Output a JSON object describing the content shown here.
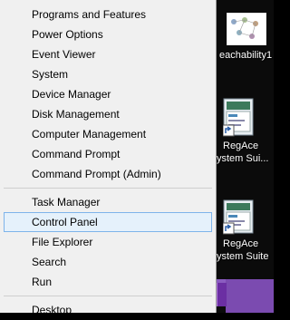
{
  "menu": {
    "group1": [
      "Programs and Features",
      "Power Options",
      "Event Viewer",
      "System",
      "Device Manager",
      "Disk Management",
      "Computer Management",
      "Command Prompt",
      "Command Prompt (Admin)"
    ],
    "group2": [
      "Task Manager",
      "Control Panel",
      "File Explorer",
      "Search",
      "Run"
    ],
    "group3": [
      "Desktop"
    ],
    "highlighted": "Control Panel"
  },
  "desktop": {
    "icons": [
      {
        "label_line1": "eachability1",
        "label_line2": "",
        "icon": "network-diagram-icon"
      },
      {
        "label_line1": "RegAce",
        "label_line2": "ystem Sui...",
        "icon": "regace-shortcut-icon"
      },
      {
        "label_line1": "RegAce",
        "label_line2": "ystem Suite",
        "icon": "regace-shortcut-icon"
      }
    ]
  },
  "colors": {
    "menu_bg": "#f0f0f0",
    "highlight_bg": "#e5f1fb",
    "highlight_border": "#7eb4ea",
    "taskbar": "#7b4bb0"
  }
}
